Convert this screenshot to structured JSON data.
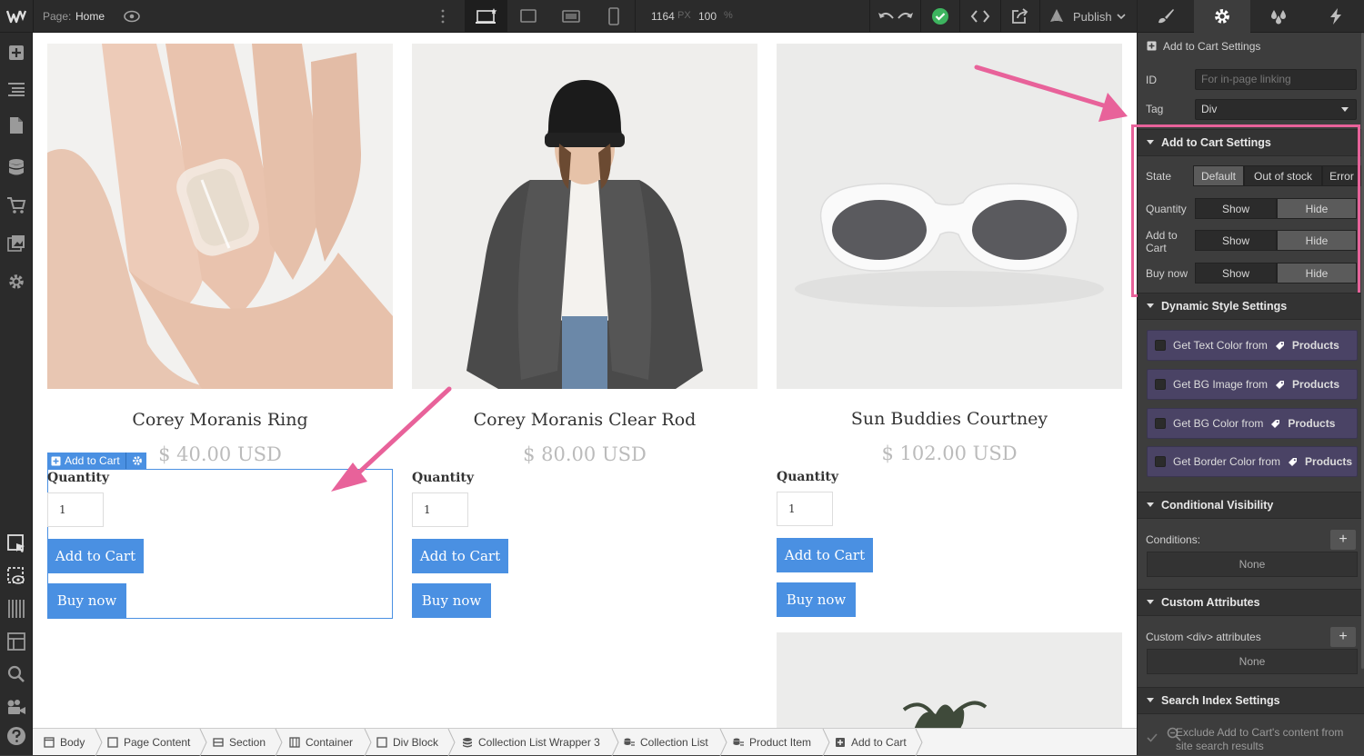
{
  "topbar": {
    "page_label": "Page:",
    "page_name": "Home",
    "width_value": "1164",
    "width_unit": "PX",
    "zoom_value": "100",
    "zoom_unit": "%",
    "publish_label": "Publish"
  },
  "products": [
    {
      "title": "Corey Moranis Ring",
      "price": "$ 40.00 USD",
      "quantity_label": "Quantity",
      "quantity_value": "1",
      "add_to_cart_label": "Add to Cart",
      "buy_now_label": "Buy now"
    },
    {
      "title": "Corey Moranis Clear Rod",
      "price": "$ 80.00 USD",
      "quantity_label": "Quantity",
      "quantity_value": "1",
      "add_to_cart_label": "Add to Cart",
      "buy_now_label": "Buy now"
    },
    {
      "title": "Sun Buddies Courtney",
      "price": "$ 102.00 USD",
      "quantity_label": "Quantity",
      "quantity_value": "1",
      "add_to_cart_label": "Add to Cart",
      "buy_now_label": "Buy now"
    }
  ],
  "selection_tag": {
    "label": "Add to Cart"
  },
  "breadcrumb": {
    "items": [
      "Body",
      "Page Content",
      "Section",
      "Container",
      "Div Block",
      "Collection List Wrapper 3",
      "Collection List",
      "Product Item",
      "Add to Cart"
    ]
  },
  "panel": {
    "header_title": "Add to Cart Settings",
    "id_label": "ID",
    "id_placeholder": "For in-page linking",
    "tag_label": "Tag",
    "tag_value": "Div",
    "add_to_cart_settings": {
      "title": "Add to Cart Settings",
      "state_label": "State",
      "state_options": [
        "Default",
        "Out of stock",
        "Error"
      ],
      "quantity_label": "Quantity",
      "add_to_cart_label": "Add to Cart",
      "buy_now_label": "Buy now",
      "show_label": "Show",
      "hide_label": "Hide"
    },
    "dynamic_style": {
      "title": "Dynamic Style Settings",
      "source": "Products",
      "rows": [
        "Get Text Color from",
        "Get BG Image from",
        "Get BG Color from",
        "Get Border Color from"
      ]
    },
    "conditional_visibility": {
      "title": "Conditional Visibility",
      "conditions_label": "Conditions:",
      "none_label": "None"
    },
    "custom_attributes": {
      "title": "Custom Attributes",
      "attrs_label": "Custom <div> attributes",
      "none_label": "None"
    },
    "search_index": {
      "title": "Search Index Settings",
      "exclude_text": "Exclude Add to Cart's content from site search results"
    }
  },
  "colors": {
    "accent_blue": "#4a90e2",
    "annotation_pink": "#e8629a",
    "publish_green": "#3db45f",
    "dynamic_row_bg": "#4a4365"
  }
}
